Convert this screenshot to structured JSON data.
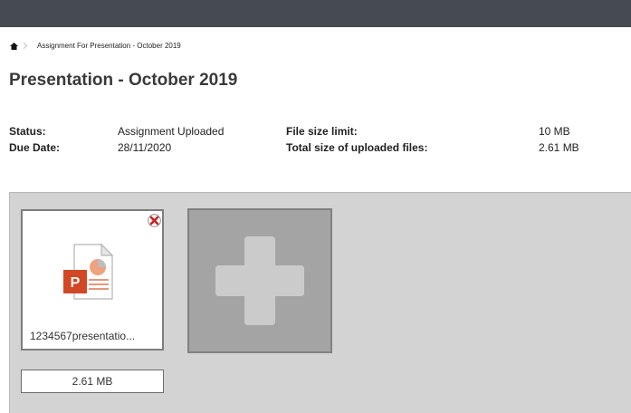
{
  "breadcrumb": {
    "home_icon": "home-icon",
    "current": "Assignment For Presentation - October 2019"
  },
  "page": {
    "title": "Presentation - October 2019"
  },
  "details": {
    "status_label": "Status:",
    "status_value": "Assignment Uploaded",
    "due_label": "Due Date:",
    "due_value": "28/11/2020",
    "limit_label": "File size limit:",
    "limit_value": "10 MB",
    "total_label": "Total size of uploaded files:",
    "total_value": "2.61 MB"
  },
  "files": [
    {
      "name": "1234567presentatio...",
      "size": "2.61 MB",
      "type_icon": "powerpoint-file-icon",
      "remove_icon": "remove-icon"
    }
  ],
  "add_button": {
    "icon": "plus-icon"
  },
  "colors": {
    "topbar": "#464b51",
    "upload_area": "#d3d3d3",
    "add_card": "#a4a4a4",
    "remove_red": "#cc1f1f",
    "powerpoint_orange": "#d24726"
  }
}
